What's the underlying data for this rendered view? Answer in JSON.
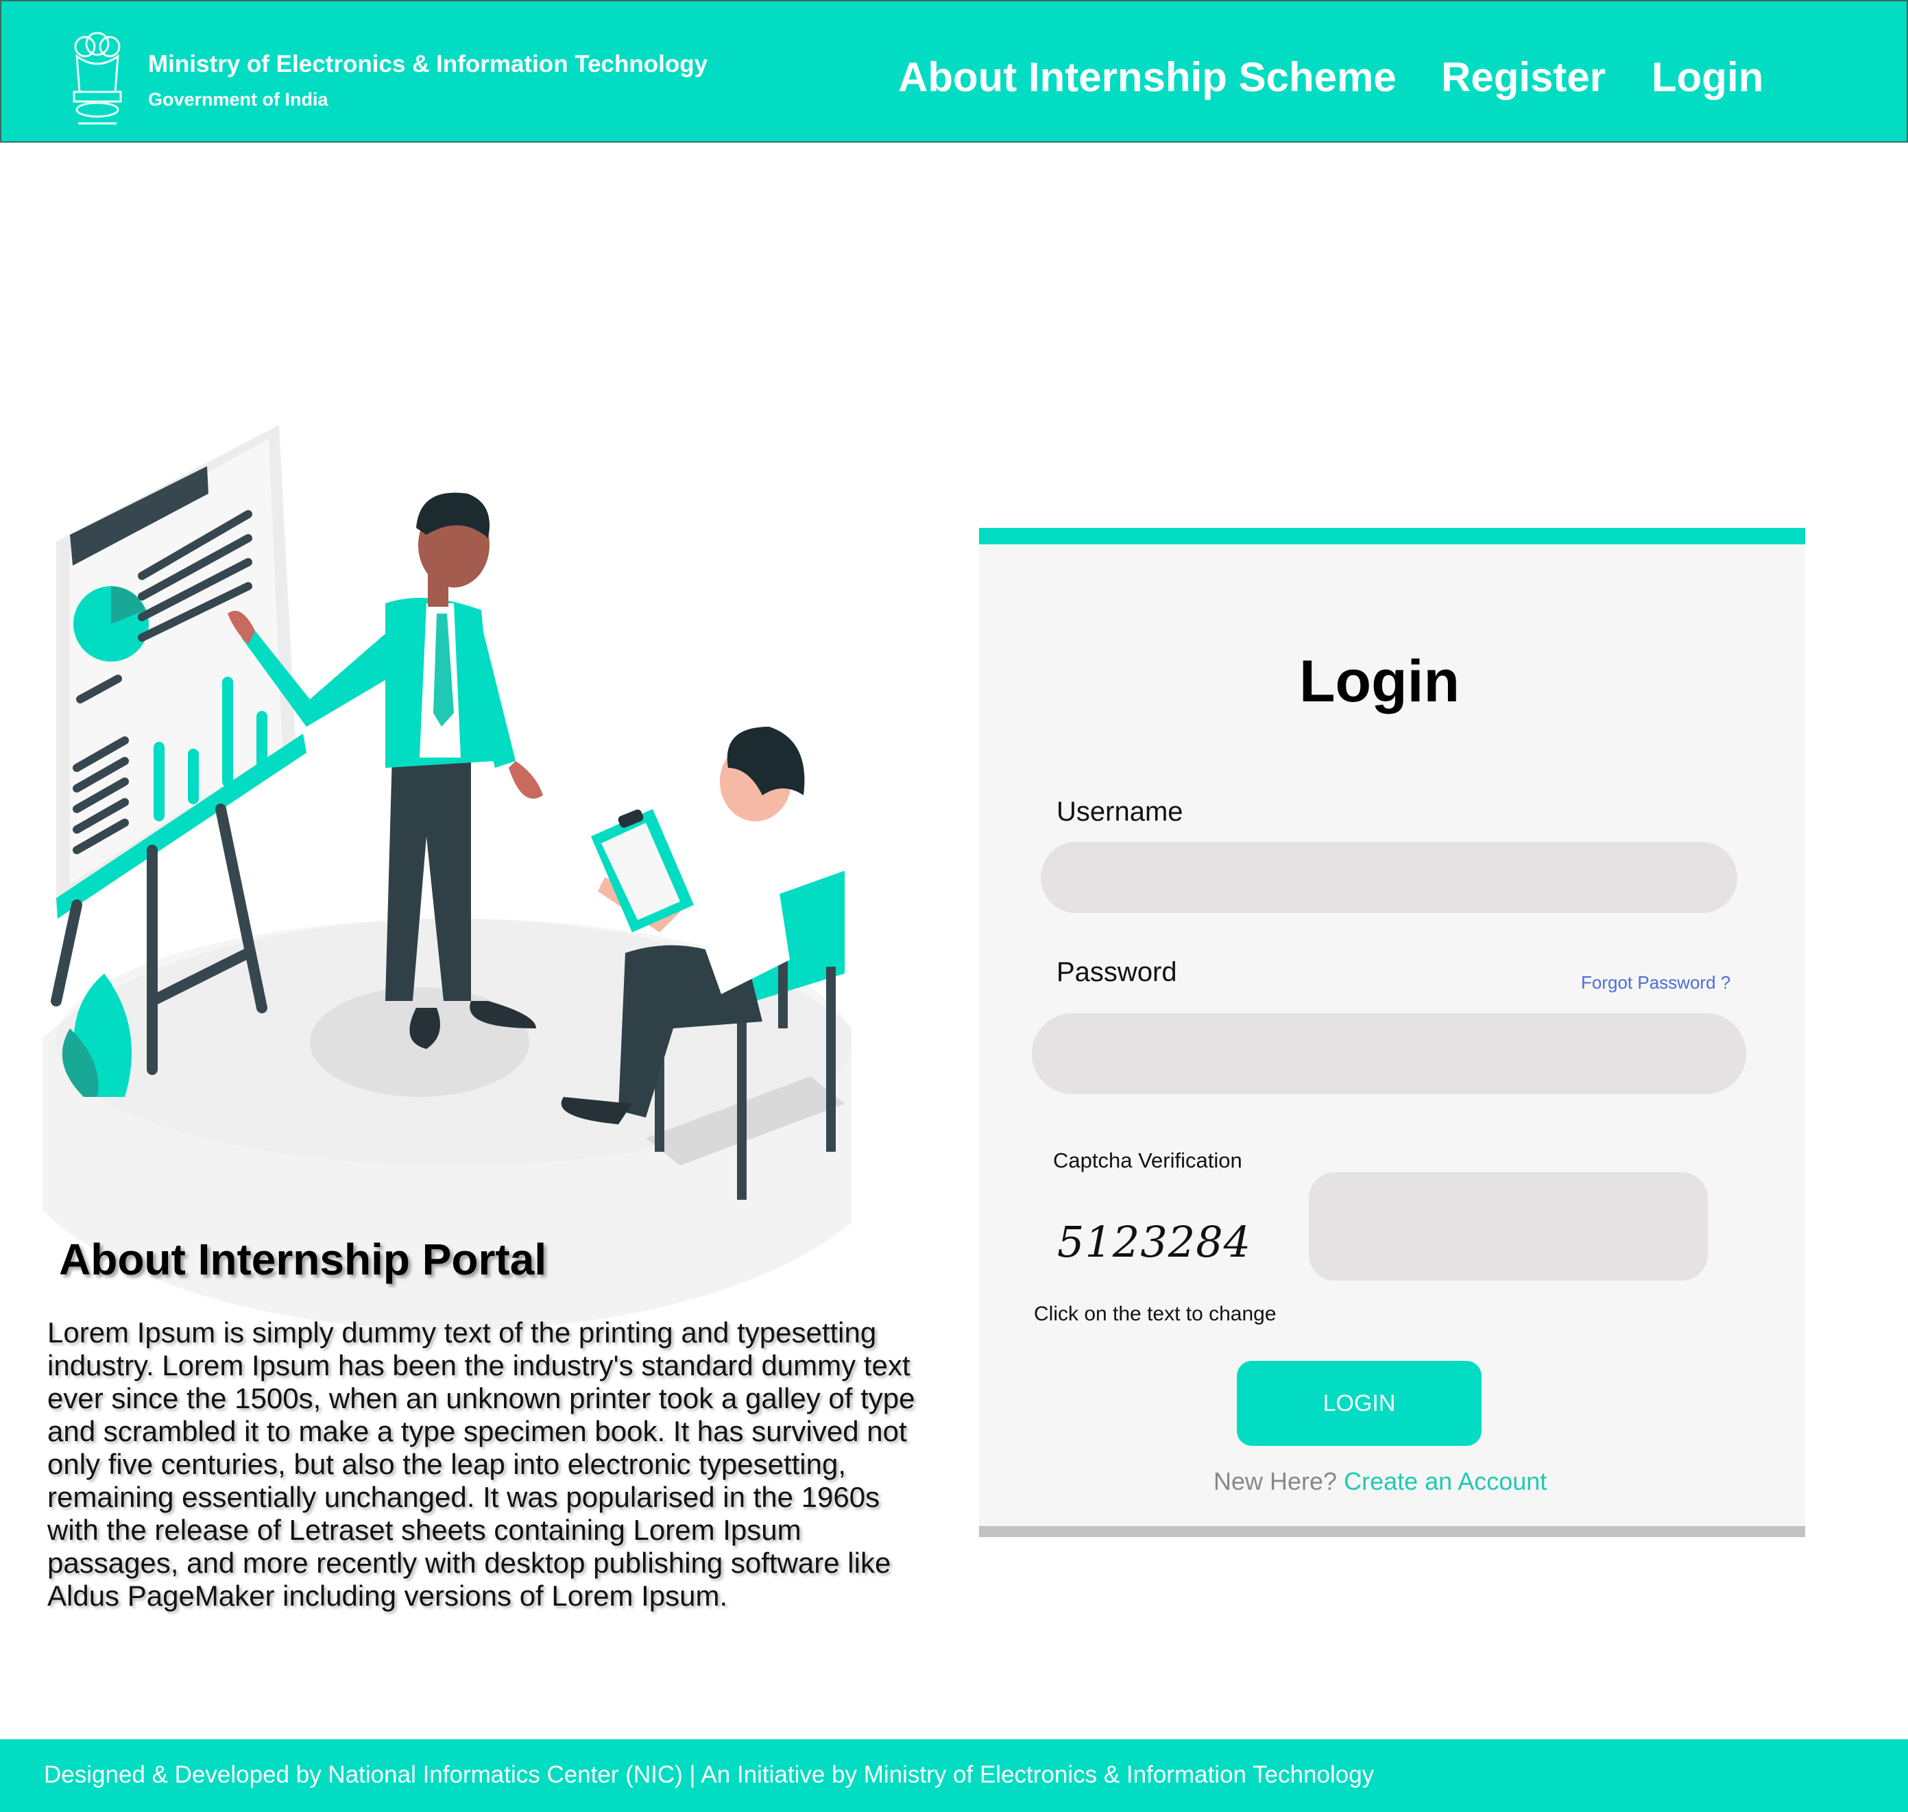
{
  "header": {
    "ministry_title": "Ministry of Electronics & Information Technology",
    "ministry_subtitle": "Government of India",
    "emblem_icon": "national-emblem-icon",
    "nav": [
      {
        "label": "About Internship Scheme"
      },
      {
        "label": "Register"
      },
      {
        "label": "Login"
      }
    ]
  },
  "about": {
    "heading": "About Internship Portal",
    "body": "Lorem Ipsum is simply dummy text of the printing and typesetting industry. Lorem Ipsum has been the industry's standard dummy text ever since the 1500s, when an unknown printer took a galley of type and scrambled it to make a type specimen book. It has survived not only five centuries, but also the leap into electronic typesetting, remaining essentially unchanged. It was popularised in the 1960s with the release of Letraset sheets containing Lorem Ipsum passages, and more recently with desktop publishing software like Aldus PageMaker including versions of Lorem Ipsum."
  },
  "login": {
    "title": "Login",
    "username_label": "Username",
    "username_value": "",
    "password_label": "Password",
    "password_value": "",
    "forgot_password": "Forgot Password ?",
    "captcha_label": "Captcha Verification",
    "captcha_text": "5123284",
    "captcha_value": "",
    "captcha_hint": "Click on the text to change",
    "button_label": "LOGIN",
    "new_here": "New Here?",
    "create_account": "Create an Account"
  },
  "footer": {
    "text": "Designed & Developed by National Informatics Center (NIC) | An  Initiative by Ministry of Electronics & Information Technology"
  },
  "colors": {
    "accent": "#02dcc2",
    "input_bg": "#e4e2e3",
    "card_bg": "#f6f6f6",
    "link_blue": "#4a6fd6"
  }
}
